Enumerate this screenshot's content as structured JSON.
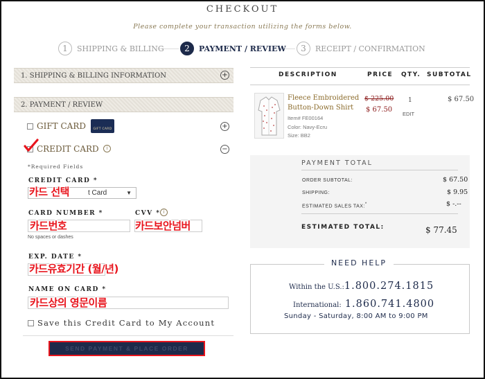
{
  "header": {
    "title": "CHECKOUT",
    "subtitle": "Please complete your transaction utilizing the forms below."
  },
  "steps": [
    {
      "num": "1",
      "label": "SHIPPING & BILLING"
    },
    {
      "num": "2",
      "label": "PAYMENT / REVIEW"
    },
    {
      "num": "3",
      "label": "RECEIPT / CONFIRMATION"
    }
  ],
  "left": {
    "panel1_label": "1. SHIPPING & BILLING INFORMATION",
    "panel2_label": "2. PAYMENT / REVIEW",
    "expand_glyph": "+",
    "collapse_glyph": "−",
    "gift_card_label": "GIFT CARD",
    "gift_card_image_text": "GIFT CARD",
    "credit_card_label": "CREDIT CARD",
    "info_glyph": "i",
    "required_note": "*Required Fields",
    "credit_card_field_label": "CREDIT CARD *",
    "credit_card_select_value": "t Card",
    "card_number_label": "CARD NUMBER *",
    "card_number_hint": "No spaces or dashes",
    "cvv_label": "CVV *",
    "exp_date_label": "EXP. DATE *",
    "name_on_card_label": "NAME ON CARD *",
    "save_card_label": "Save this Credit Card to My Account",
    "send_button_label": "SEND PAYMENT & PLACE ORDER"
  },
  "annotations": {
    "card_select": "카드 선택",
    "card_number": "카드번호",
    "cvv": "카드보안넘버",
    "exp_date": "카드유효기간 (월/년)",
    "name_on_card": "카드상의 영문이름"
  },
  "order": {
    "headers": {
      "description": "DESCRIPTION",
      "price": "PRICE",
      "qty": "QTY.",
      "subtotal": "SUBTOTAL"
    },
    "item": {
      "name_line1": "Fleece Embroidered",
      "name_line2": "Button-Down Shirt",
      "item_no": "Item# FE00164",
      "color": "Color: Navy-Ecru",
      "size": "Size: BB2",
      "price_old": "$ 225.00",
      "price_new": "$ 67.50",
      "qty": "1",
      "edit": "EDIT",
      "subtotal": "$ 67.50"
    }
  },
  "totals": {
    "title": "PAYMENT TOTAL",
    "order_subtotal_label": "ORDER SUBTOTAL:",
    "order_subtotal_value": "$ 67.50",
    "shipping_label": "SHIPPING:",
    "shipping_value": "$ 9.95",
    "tax_label": "ESTIMATED SALES TAX:",
    "tax_asterisk": "*",
    "tax_value": "$ -.--",
    "estimated_total_label": "ESTIMATED TOTAL:",
    "estimated_total_value": "$ 77.45"
  },
  "help": {
    "title": "NEED HELP",
    "us_label": "Within the U.S.:",
    "us_number": "1.800.274.1815",
    "intl_label": "International:",
    "intl_number": "1.860.741.4800",
    "hours": "Sunday - Saturday, 8:00 AM to 9:00 PM"
  },
  "colors": {
    "navy": "#1d2a4a",
    "annotation_red": "#e8141c",
    "price_red": "#8b1a1a",
    "gold": "#8a7a55"
  }
}
